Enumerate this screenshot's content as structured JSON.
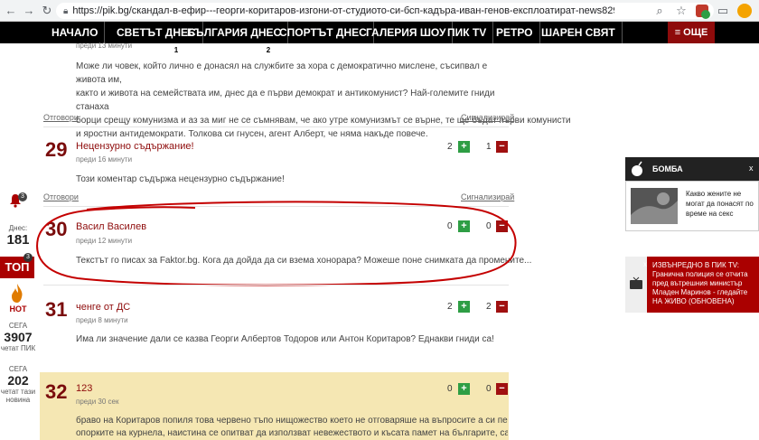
{
  "browser": {
    "url": "https://pik.bg/скандал-в-ефир---георги-коритаров-изгони-от-студиото-си-бсп-кадъра-иван-генов-експлоатират-news829058.html"
  },
  "nav": {
    "items": [
      {
        "label": "НАЧАЛО"
      },
      {
        "label": "СВЕТЪТ ДНЕС",
        "badge": "1"
      },
      {
        "label": "БЪЛГАРИЯ ДНЕС",
        "badge": "2"
      },
      {
        "label": "СПОРТЪТ ДНЕС"
      },
      {
        "label": "ГАЛЕРИЯ ШОУ"
      },
      {
        "label": "ПИК TV"
      },
      {
        "label": "РЕТРО"
      },
      {
        "label": "ШАРЕН СВЯТ"
      }
    ],
    "more": "≡ ОЩЕ"
  },
  "rail": {
    "bell_badge": "3",
    "today_label": "Днес:",
    "today_count": "181",
    "top_label": "ТОП",
    "top_badge": "3",
    "hot_label": "HOT",
    "now1_label": "СЕГА",
    "now1_count": "3907",
    "now1_sub": "четат ПИК",
    "now2_label": "СЕГА",
    "now2_count": "202",
    "now2_sub1": "четат тази",
    "now2_sub2": "новина"
  },
  "prev_comment": {
    "time": "преди 13 минути",
    "lines": [
      "Може ли човек, който лично е донасял на службите за хора с демократично мислене, съсипвал е живота им,",
      "както и живота на семействата им, днес да е първи демократ и антикомунист? Най-големите гниди станаха",
      "борци срещу комунизма и аз за миг не се съмнявам, че ако утре комунизмът се върне, те ще бъдат първи комунисти",
      "и яростни антидемократи. Толкова си гнусен, агент Алберт, че няма накъде повече."
    ]
  },
  "actions": {
    "reply": "Отговори",
    "report": "Сигнализирай"
  },
  "comments": [
    {
      "num": "29",
      "author": "Нецензурно съдържание!",
      "time": "преди 16 минути",
      "up": "2",
      "down": "1",
      "text": "Този коментар съдържа нецензурно съдържание!"
    },
    {
      "num": "30",
      "author": "Васил Василев",
      "time": "преди 12 минути",
      "up": "0",
      "down": "0",
      "text": "Текстът го писах за Faktor.bg. Кога да дойда да си взема хонорара? Можеше поне снимката да промените..."
    },
    {
      "num": "31",
      "author": "ченге от ДС",
      "time": "преди 8 минути",
      "up": "2",
      "down": "2",
      "text": "Има ли значение дали се казва Георги Албертов Тодоров или Антон Коритаров? Еднакви гниди са!"
    },
    {
      "num": "32",
      "author": "123",
      "time": "преди 30 сек",
      "up": "0",
      "down": "0",
      "text1": "браво на Коритаров попиля това червено тъпо нищожество което не отговаряше на въпросите а си пееше",
      "text2": "опорките на курнела, наистина се опитват да използват невежеството и късата памет на българите, само че"
    }
  ],
  "bomb": {
    "title": "БОМБА",
    "close": "x",
    "text": "Какво жените не могат да понасят по време на секс"
  },
  "breaking": {
    "close": "x",
    "text": "ИЗВЪНРЕДНО В ПИК TV: Гранична полиция се отчита пред вътрешния министър Младен Маринов - гледайте НА ЖИВО (ОБНОВЕНА)"
  },
  "colors": {
    "brand_red": "#8e0b0b",
    "plus_green": "#2e9e44",
    "nav_black": "#000000",
    "highlight": "#f5e7b3"
  }
}
